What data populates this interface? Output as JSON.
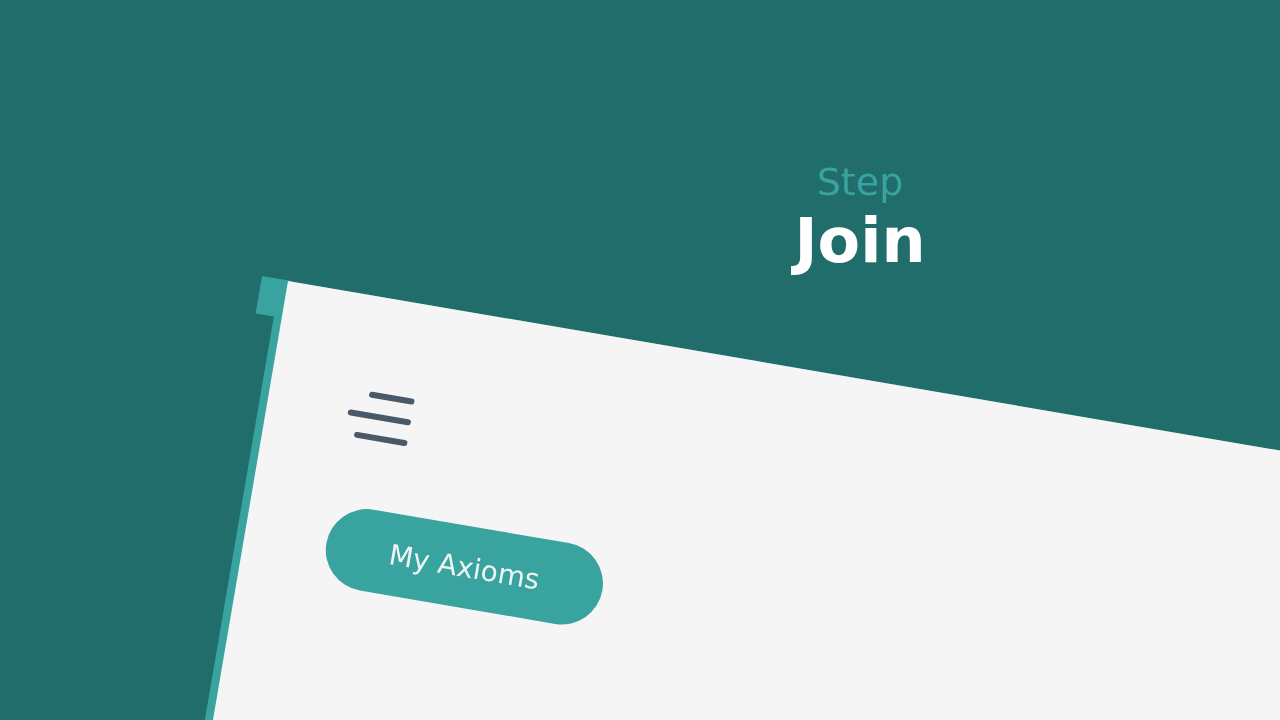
{
  "header": {
    "eyebrow": "Step",
    "title": "Join"
  },
  "app_screen": {
    "button": {
      "label": "My Axioms"
    }
  }
}
